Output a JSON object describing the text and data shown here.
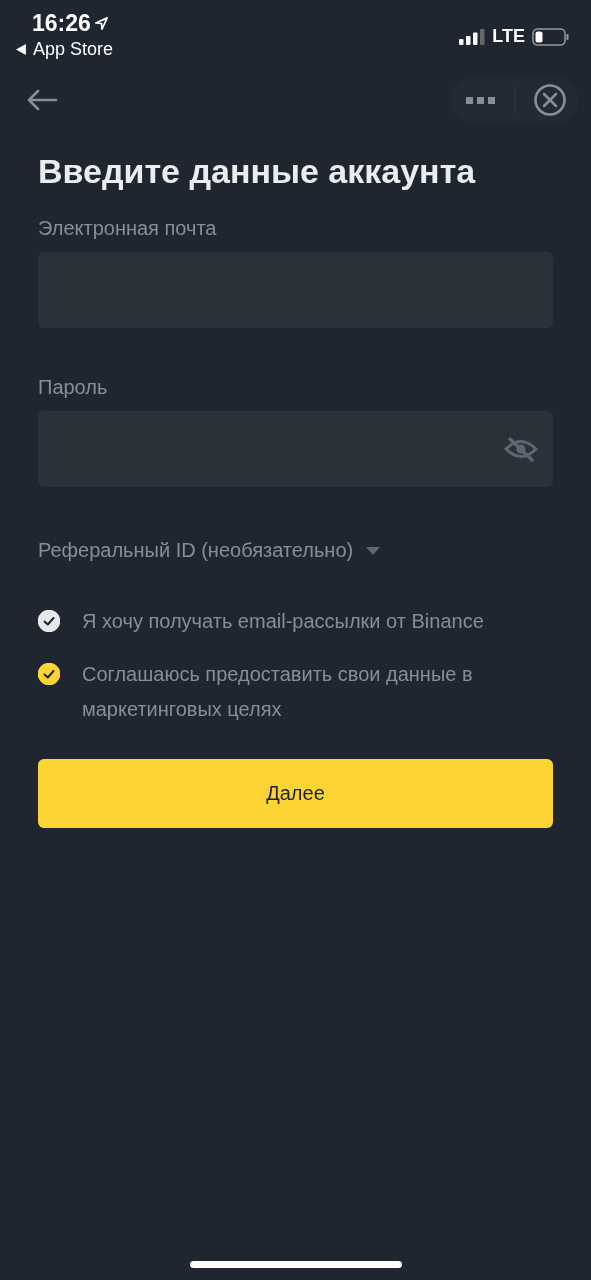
{
  "status_bar": {
    "time": "16:26",
    "back_app": "App Store",
    "network": "LTE"
  },
  "title": "Введите данные аккаунта",
  "fields": [
    {
      "label": "Электронная почта",
      "kind": "text"
    },
    {
      "label": "Пароль",
      "kind": "password"
    }
  ],
  "referral": {
    "label": "Реферальный ID (необязательно)",
    "expanded": false
  },
  "consents": [
    {
      "text": "Я хочу получать email-рассылки от Binance",
      "checked": true,
      "color": "#e6e8ec"
    },
    {
      "text": "Соглашаюсь предоставить свои данные в маркетинговых целях",
      "checked": true,
      "color": "#fcd535"
    }
  ],
  "primary_button": "Далее"
}
